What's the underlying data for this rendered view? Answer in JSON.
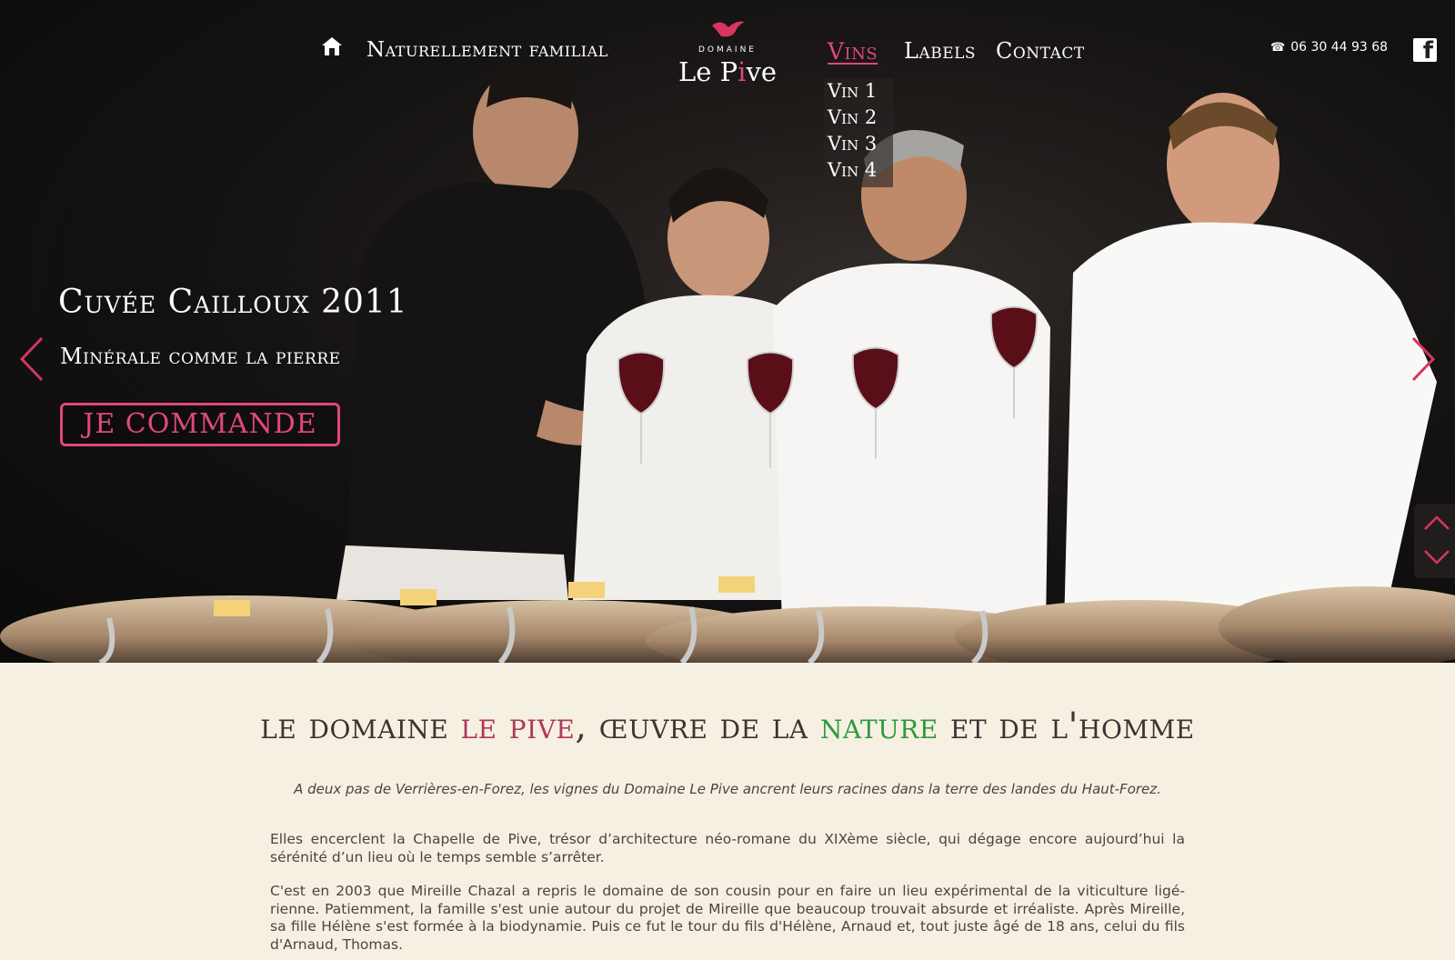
{
  "nav": {
    "home_icon": "home-icon",
    "naturellement": "Naturellement familial",
    "vins": "Vins",
    "labels": "Labels",
    "contact": "Contact",
    "vins_menu": [
      "Vin 1",
      "Vin 2",
      "Vin 3",
      "Vin 4"
    ]
  },
  "logo": {
    "domaine": "DOMAINE",
    "name_part1": "Le P",
    "name_accent": "i",
    "name_part2": "ve"
  },
  "contact": {
    "phone_icon": "phone-icon",
    "phone": "06 30 44 93 68",
    "facebook_icon": "facebook-icon"
  },
  "slide": {
    "title": "Cuvée Cailloux 2011",
    "subtitle": "Minérale comme la pierre",
    "cta": "JE COMMANDE"
  },
  "content": {
    "headline_1": "le domaine ",
    "headline_pink": "le pive",
    "headline_2": ", œuvre de la ",
    "headline_green": "nature",
    "headline_3": " et de l'homme",
    "intro": "A deux pas de Verrières-en-Forez, les vignes du Domaine Le Pive ancrent leurs racines dans la terre des landes du Haut-Forez.",
    "paragraph_1": "Elles encerclent la Chapelle de Pive, trésor d’architecture néo-romane du XIXème siècle, qui dégage encore aujourd’hui la sérénité d’un lieu où le temps semble s’arrêter.",
    "paragraph_2": "C'est en 2003 que Mireille Chazal a repris le domaine de son cousin pour en faire un lieu expérimental de la viticulture ligé-rienne. Patiemment, la famille s'est unie autour du projet de Mireille que beaucoup trouvait absurde et irréaliste. Après Mireille, sa fille Hélène s'est formée à la biodynamie. Puis ce fut le tour du fils d'Hélène, Arnaud et, tout juste âgé de 18 ans, celui du fils d'Arnaud, Thomas."
  },
  "colors": {
    "accent_pink": "#e0487b",
    "headline_pink": "#b0385f",
    "nature_green": "#2f9a3f",
    "page_background": "#f6f0e2"
  }
}
